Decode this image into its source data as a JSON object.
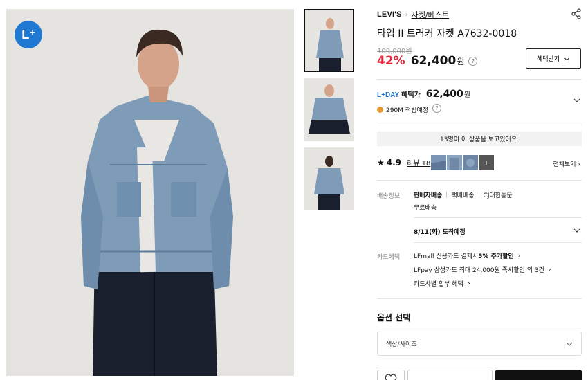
{
  "badge": {
    "letter": "L",
    "plus": "+"
  },
  "breadcrumb": {
    "brand": "LEVI'S",
    "separator": "›",
    "category": "자켓/베스트"
  },
  "product": {
    "title": "타입 II 트러커 자켓 A7632-0018",
    "original_price": "109,000원",
    "discount": "42%",
    "price": "62,400",
    "currency": "원"
  },
  "benefit_button": {
    "label": "혜택받기",
    "icon": "download-icon"
  },
  "lday": {
    "tag": "L+DAY",
    "label": "혜택가",
    "amount": "62,400",
    "currency": "원",
    "points": "290M 적립예정"
  },
  "viewers": "13명이 이 상품을 보고있어요.",
  "rating": {
    "star": "★",
    "score": "4.9",
    "review": "리뷰 18",
    "view_all": "전체보기",
    "extra_photos": "+"
  },
  "shipping": {
    "label": "배송정보",
    "options": [
      "판매자배송",
      "택배배송",
      "CJ대한통운"
    ],
    "fee": "무료배송",
    "arrival": "8/11(화) 도착예정"
  },
  "card": {
    "label": "카드혜택",
    "line1_pre": "LFmall 신용카드 결제시 ",
    "line1_bold": "5% 추가할인",
    "line2": "LFpay 삼성카드 최대 24,000원 즉시할인 외 3건",
    "line3": "카드사별 할부 혜택"
  },
  "options": {
    "title": "옵션 선택",
    "placeholder": "색상/사이즈"
  },
  "colors": {
    "discount": "#e0283b",
    "lday": "#1f78d1",
    "badge": "#1f78d1",
    "buy": "#111111"
  }
}
